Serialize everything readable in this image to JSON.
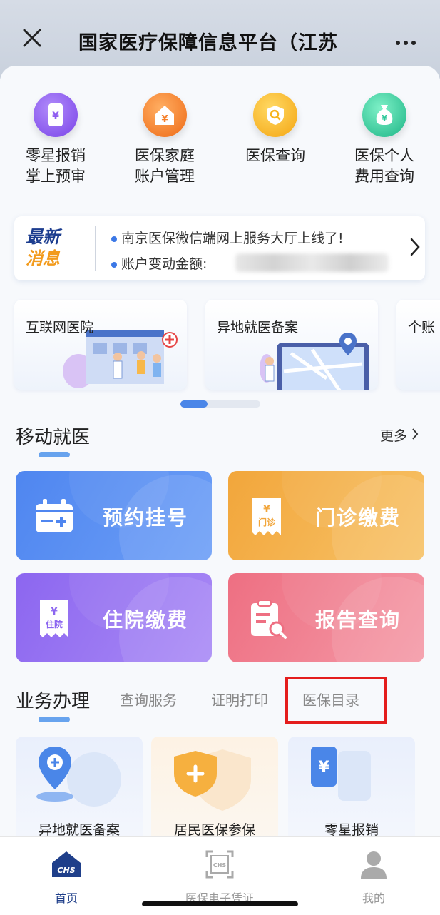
{
  "topbar": {
    "title": "国家医疗保障信息平台（江苏",
    "close_icon": "close-icon",
    "more_icon": "more-dots-icon"
  },
  "quick_actions": [
    {
      "label": "零星报销\n掌上预审",
      "icon": "phone-yen-icon",
      "color": "#8e5cf0"
    },
    {
      "label": "医保家庭\n账户管理",
      "icon": "house-yen-icon",
      "color": "#f5802b"
    },
    {
      "label": "医保查询",
      "icon": "search-badge-icon",
      "color": "#f7b51f"
    },
    {
      "label": "医保个人\n费用查询",
      "icon": "money-bag-icon",
      "color": "#2fc89a"
    }
  ],
  "news": {
    "badge_line1": "最新",
    "badge_line2": "消息",
    "items": [
      "南京医保微信端网上服务大厅上线了!",
      "账户变动金额:"
    ]
  },
  "banners": [
    {
      "label": "互联网医院"
    },
    {
      "label": "异地就医备案"
    },
    {
      "label": "个账"
    }
  ],
  "mobile_medical": {
    "title": "移动就医",
    "more": "更多",
    "tiles": [
      {
        "label": "预约挂号",
        "icon": "appointment-icon",
        "color_from": "#4f86f0",
        "color_to": "#6c9ef6"
      },
      {
        "label": "门诊缴费",
        "icon": "outpatient-bill-icon",
        "color_from": "#f2a63b",
        "color_to": "#f7c267"
      },
      {
        "label": "住院缴费",
        "icon": "inpatient-bill-icon",
        "color_from": "#8c66f0",
        "color_to": "#a98af5"
      },
      {
        "label": "报告查询",
        "icon": "report-search-icon",
        "color_from": "#ee6f82",
        "color_to": "#f49aa7"
      }
    ]
  },
  "business": {
    "title": "业务办理",
    "tabs": [
      "查询服务",
      "证明打印",
      "医保目录"
    ],
    "cards": [
      {
        "label": "异地就医备案",
        "icon": "location-plus-icon"
      },
      {
        "label": "居民医保参保",
        "icon": "shield-plus-icon"
      },
      {
        "label": "零星报销",
        "icon": "phone-yen-icon"
      }
    ]
  },
  "bottom_nav": [
    {
      "label": "首页",
      "icon": "home-chs-icon",
      "active": true
    },
    {
      "label": "医保电子凭证",
      "icon": "qr-code-icon",
      "active": false
    },
    {
      "label": "我的",
      "icon": "user-icon",
      "active": false
    }
  ]
}
